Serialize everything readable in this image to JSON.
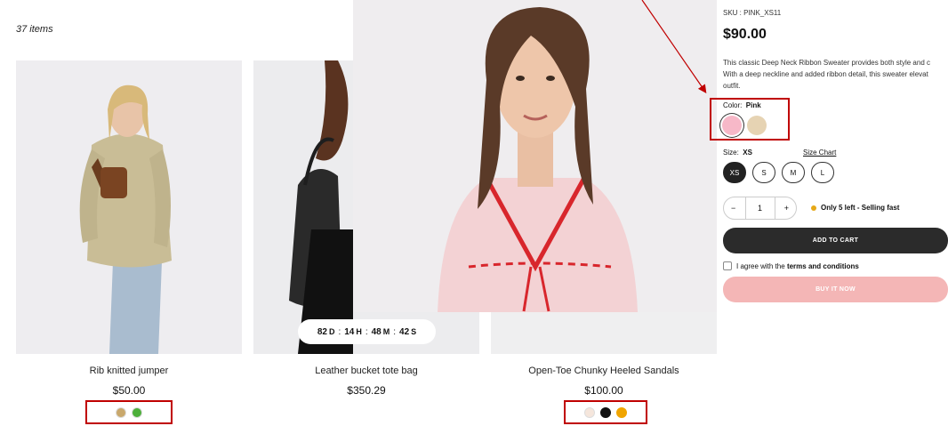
{
  "listing": {
    "items_count": "37 items",
    "timer": {
      "days": "82",
      "d": "D",
      "hours": "14",
      "h": "H",
      "minutes": "48",
      "m": "M",
      "seconds": "42",
      "s": "S"
    },
    "products": [
      {
        "title": "Rib knitted jumper",
        "price": "$50.00",
        "swatches": [
          "#c9a86c",
          "#4caf3a"
        ]
      },
      {
        "title": "Leather bucket tote bag",
        "price": "$350.29",
        "swatches": []
      },
      {
        "title": "Open-Toe Chunky Heeled Sandals",
        "price": "$100.00",
        "swatches": [
          "#f5e6dc",
          "#111111",
          "#f0a500"
        ]
      }
    ]
  },
  "product": {
    "sku": "SKU : PINK_XS11",
    "price": "$90.00",
    "description_lines": [
      "This classic Deep Neck Ribbon Sweater provides both style and c",
      "With a deep neckline and added ribbon detail, this sweater elevat",
      "outfit."
    ],
    "color_label": "Color:",
    "color_value": "Pink",
    "colors": [
      "#f7b8c8",
      "#e6d3b3"
    ],
    "size_label": "Size:",
    "size_value": "XS",
    "size_chart": "Size Chart",
    "sizes": [
      "XS",
      "S",
      "M",
      "L"
    ],
    "quantity": "1",
    "minus": "−",
    "plus": "+",
    "stock_text": "Only 5 left - Selling fast",
    "add_to_cart": "ADD TO CART",
    "terms_prefix": "I agree with the",
    "terms_link": "terms and conditions",
    "buy_now": "BUY IT NOW"
  }
}
